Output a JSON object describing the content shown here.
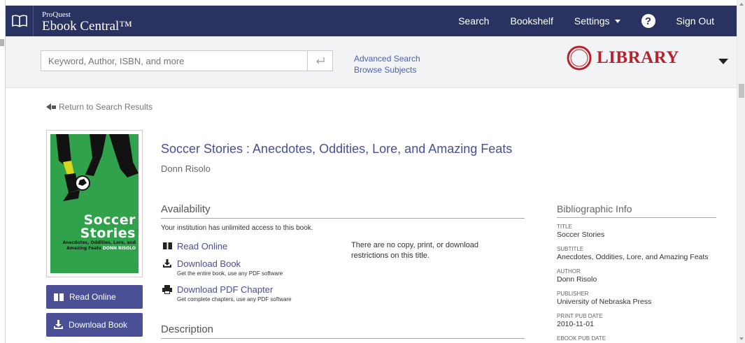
{
  "header": {
    "brand_small": "ProQuest",
    "brand_big": "Ebook Central™",
    "nav": {
      "search": "Search",
      "bookshelf": "Bookshelf",
      "settings": "Settings",
      "signout": "Sign Out"
    }
  },
  "searchbar": {
    "placeholder": "Keyword, Author, ISBN, and more",
    "advanced_search": "Advanced Search",
    "browse_subjects": "Browse Subjects",
    "library_logo": "LIBRARY"
  },
  "return_link": "Return to Search Results",
  "cover": {
    "title": "Soccer\nStories",
    "subtitle": "Anecdotes, Oddities, Lore, and Amazing Feats",
    "author": "DONN RISOLO"
  },
  "side_buttons": {
    "read_online": "Read Online",
    "download_book": "Download Book"
  },
  "book": {
    "title": "Soccer Stories : Anecdotes, Oddities, Lore, and Amazing Feats",
    "author": "Donn Risolo"
  },
  "availability": {
    "heading": "Availability",
    "access_note": "Your institution has unlimited access to this book.",
    "read_online": "Read Online",
    "download_book": "Download Book",
    "download_book_sub": "Get the entire book, use any PDF software",
    "download_chapter": "Download PDF Chapter",
    "download_chapter_sub": "Get complete chapters, use any PDF software",
    "restrictions": "There are no copy, print, or download restrictions on this title."
  },
  "description": {
    "heading": "Description"
  },
  "bibliographic": {
    "heading": "Bibliographic Info",
    "fields": [
      {
        "key": "TITLE",
        "value": "Soccer Stories"
      },
      {
        "key": "SUBTITLE",
        "value": "Anecdotes, Oddities, Lore, and Amazing Feats"
      },
      {
        "key": "AUTHOR",
        "value": "Donn Risolo"
      },
      {
        "key": "PUBLISHER",
        "value": "University of Nebraska Press"
      },
      {
        "key": "PRINT PUB DATE",
        "value": "2010-11-01"
      },
      {
        "key": "EBOOK PUB DATE",
        "value": ""
      }
    ]
  },
  "colors": {
    "header_bg": "#2a3262",
    "accent": "#4a4f96",
    "library_red": "#b8222d",
    "cover_green": "#2fa24b"
  }
}
